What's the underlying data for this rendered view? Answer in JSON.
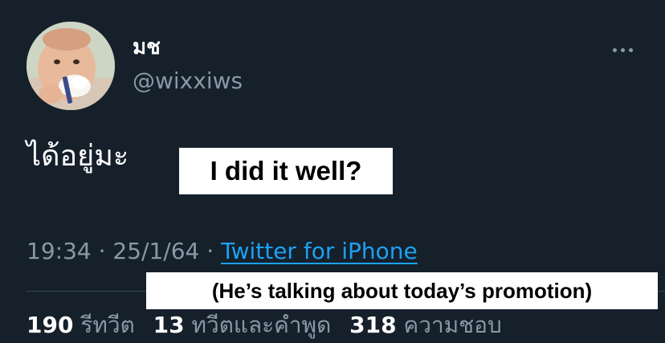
{
  "author": {
    "display_name": "มช",
    "username": "@wixxiws",
    "avatar_icon": "baby-avatar-photo"
  },
  "more_icon": "more-horizontal-icon",
  "tweet": {
    "text": "ได้อยู่มะ",
    "time": "19:34",
    "separator": "·",
    "date": "25/1/64",
    "source": "Twitter for iPhone"
  },
  "captions": {
    "translation": "I did it well?",
    "note": "(He’s talking about today’s promotion)"
  },
  "stats": {
    "retweets": {
      "count": "190",
      "label": "รีทวีต"
    },
    "quote_tweets": {
      "count": "13",
      "label": "ทวีตและคำพูด"
    },
    "likes": {
      "count": "318",
      "label": "ความชอบ"
    }
  },
  "colors": {
    "background": "#15202b",
    "secondary_text": "#8899a6",
    "link": "#1da1f2",
    "divider": "#38444d"
  }
}
